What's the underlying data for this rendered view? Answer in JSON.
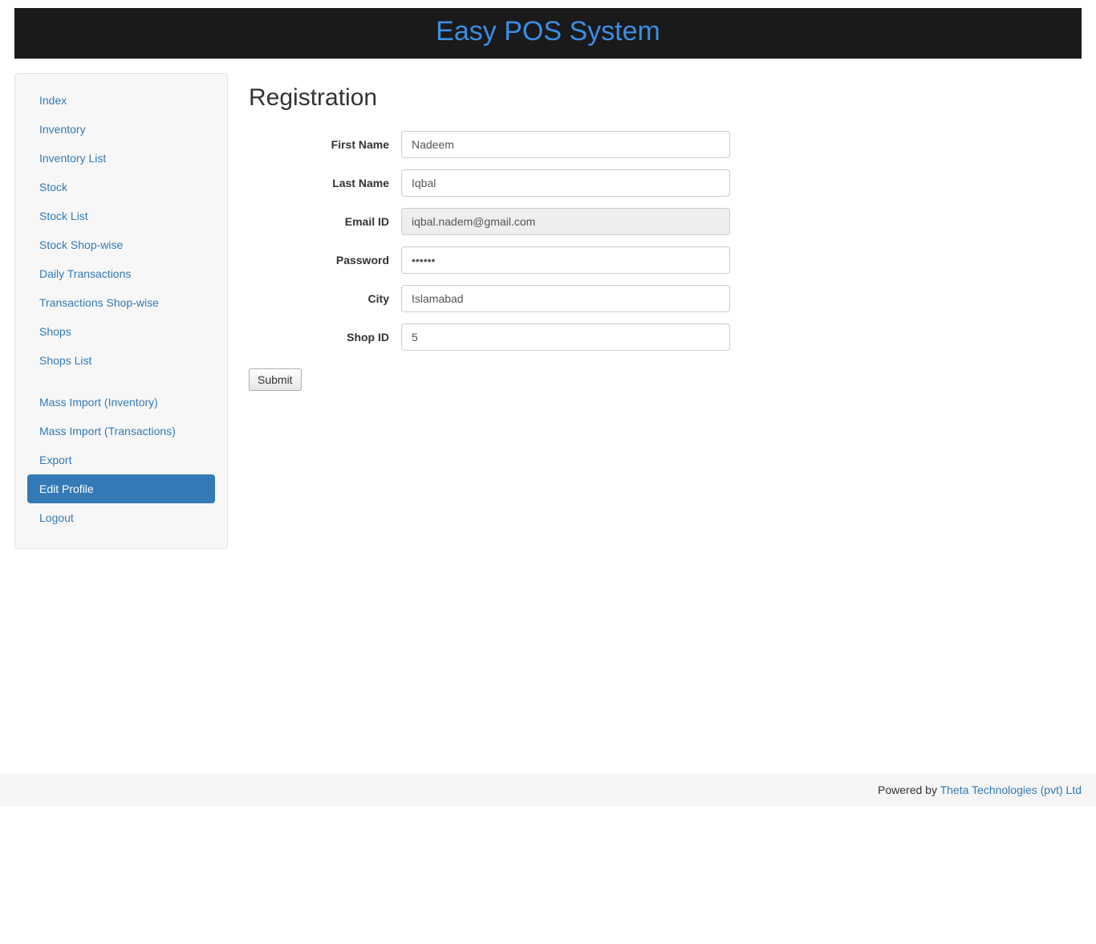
{
  "header": {
    "title": "Easy POS System"
  },
  "sidebar": {
    "items": [
      {
        "label": "Index",
        "active": false
      },
      {
        "label": "Inventory",
        "active": false
      },
      {
        "label": "Inventory List",
        "active": false
      },
      {
        "label": "Stock",
        "active": false
      },
      {
        "label": "Stock List",
        "active": false
      },
      {
        "label": "Stock Shop-wise",
        "active": false
      },
      {
        "label": "Daily Transactions",
        "active": false
      },
      {
        "label": "Transactions Shop-wise",
        "active": false
      },
      {
        "label": "Shops",
        "active": false
      },
      {
        "label": "Shops List",
        "active": false
      }
    ],
    "items2": [
      {
        "label": "Mass Import (Inventory)",
        "active": false
      },
      {
        "label": "Mass Import (Transactions)",
        "active": false
      },
      {
        "label": "Export",
        "active": false
      },
      {
        "label": "Edit Profile",
        "active": true
      },
      {
        "label": "Logout",
        "active": false
      }
    ]
  },
  "main": {
    "title": "Registration",
    "form": {
      "first_name_label": "First Name",
      "first_name_value": "Nadeem",
      "last_name_label": "Last Name",
      "last_name_value": "Iqbal",
      "email_label": "Email ID",
      "email_value": "iqbal.nadem@gmail.com",
      "password_label": "Password",
      "password_value": "••••••",
      "city_label": "City",
      "city_value": "Islamabad",
      "shop_id_label": "Shop ID",
      "shop_id_value": "5",
      "submit_label": "Submit"
    }
  },
  "footer": {
    "powered_by": "Powered by ",
    "company": "Theta Technologies (pvt) Ltd"
  }
}
